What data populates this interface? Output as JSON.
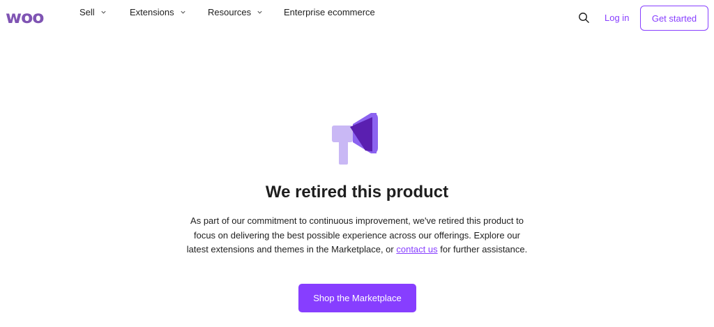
{
  "header": {
    "logo_text": "woo",
    "nav": [
      {
        "label": "Sell",
        "has_dropdown": true
      },
      {
        "label": "Extensions",
        "has_dropdown": true
      },
      {
        "label": "Resources",
        "has_dropdown": true
      },
      {
        "label": "Enterprise ecommerce",
        "has_dropdown": false
      }
    ],
    "search_icon": "search-icon",
    "login_label": "Log in",
    "get_started_label": "Get started"
  },
  "main": {
    "illustration_icon": "megaphone-icon",
    "title": "We retired this product",
    "body_before_link": "As part of our commitment to continuous improvement, we've retired this product to focus on delivering the best possible experience across our offerings. Explore our latest extensions and themes in the Marketplace, or ",
    "link_text": "contact us",
    "body_after_link": " for further assistance.",
    "cta_label": "Shop the Marketplace"
  },
  "colors": {
    "brand": "#7f54b3",
    "accent": "#873eff",
    "text": "#1e1e1e",
    "megaphone_light": "#c9b8f5",
    "megaphone_dark": "#5a1fb0"
  }
}
